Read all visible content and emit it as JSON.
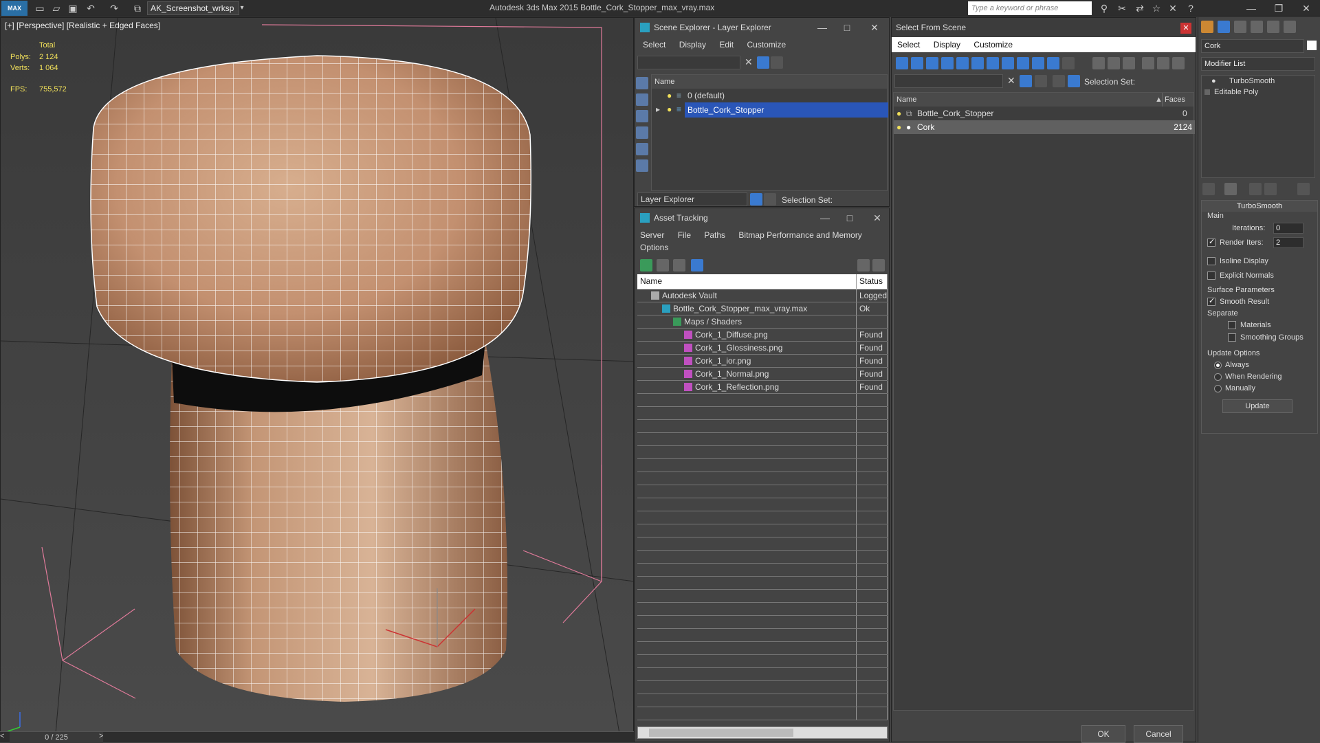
{
  "titlebar": {
    "logo": "MAX",
    "workspace": "AK_Screenshot_wrksp",
    "app_title": "Autodesk 3ds Max  2015    Bottle_Cork_Stopper_max_vray.max",
    "search_placeholder": "Type a keyword or phrase"
  },
  "viewport": {
    "label": "[+] [Perspective] [Realistic + Edged Faces]",
    "stats": {
      "total_label": "Total",
      "polys_label": "Polys:",
      "polys_value": "2 124",
      "verts_label": "Verts:",
      "verts_value": "1 064",
      "fps_label": "FPS:",
      "fps_value": "755,572"
    },
    "timeline": "0 / 225",
    "cork_colors": {
      "base": "#c79a7a",
      "dark": "#8a5a3c",
      "wire": "#ffffff"
    }
  },
  "scene_explorer": {
    "title": "Scene Explorer - Layer Explorer",
    "menu": [
      "Select",
      "Display",
      "Edit",
      "Customize"
    ],
    "column_name": "Name",
    "rows": [
      {
        "label": "0 (default)",
        "selected": false
      },
      {
        "label": "Bottle_Cork_Stopper",
        "selected": true
      }
    ],
    "footer_dropdown": "Layer Explorer",
    "selection_set_label": "Selection Set:"
  },
  "asset_tracking": {
    "title": "Asset Tracking",
    "menu_row1": [
      "Server",
      "File",
      "Paths",
      "Bitmap Performance and Memory"
    ],
    "menu_row2": [
      "Options"
    ],
    "columns": [
      "Name",
      "Status"
    ],
    "rows": [
      {
        "name": "Autodesk Vault",
        "status": "Logged",
        "indent": 0
      },
      {
        "name": "Bottle_Cork_Stopper_max_vray.max",
        "status": "Ok",
        "indent": 1
      },
      {
        "name": "Maps / Shaders",
        "status": "",
        "indent": 2
      },
      {
        "name": "Cork_1_Diffuse.png",
        "status": "Found",
        "indent": 3
      },
      {
        "name": "Cork_1_Glossiness.png",
        "status": "Found",
        "indent": 3
      },
      {
        "name": "Cork_1_ior.png",
        "status": "Found",
        "indent": 3
      },
      {
        "name": "Cork_1_Normal.png",
        "status": "Found",
        "indent": 3
      },
      {
        "name": "Cork_1_Reflection.png",
        "status": "Found",
        "indent": 3
      }
    ]
  },
  "select_from_scene": {
    "title": "Select From Scene",
    "menu": [
      "Select",
      "Display",
      "Customize"
    ],
    "selection_set_label": "Selection Set:",
    "columns": [
      "Name",
      "Faces"
    ],
    "rows": [
      {
        "name": "Bottle_Cork_Stopper",
        "faces": "0",
        "selected": false
      },
      {
        "name": "Cork",
        "faces": "2124",
        "selected": true
      }
    ],
    "ok_label": "OK",
    "cancel_label": "Cancel"
  },
  "command_panel": {
    "object_name": "Cork",
    "modifier_list": "Modifier List",
    "stack": [
      "TurboSmooth",
      "Editable Poly"
    ],
    "turbosmooth": {
      "title": "TurboSmooth",
      "main_label": "Main",
      "iterations_label": "Iterations:",
      "iterations_value": "0",
      "render_iters_label": "Render Iters:",
      "render_iters_value": "2",
      "render_iters_checked": true,
      "isoline_label": "Isoline Display",
      "explicit_label": "Explicit Normals",
      "surface_label": "Surface Parameters",
      "smooth_result_label": "Smooth Result",
      "separate_label": "Separate",
      "materials_label": "Materials",
      "smoothing_groups_label": "Smoothing Groups",
      "update_options_label": "Update Options",
      "always_label": "Always",
      "when_rendering_label": "When Rendering",
      "manually_label": "Manually",
      "update_button": "Update"
    }
  }
}
